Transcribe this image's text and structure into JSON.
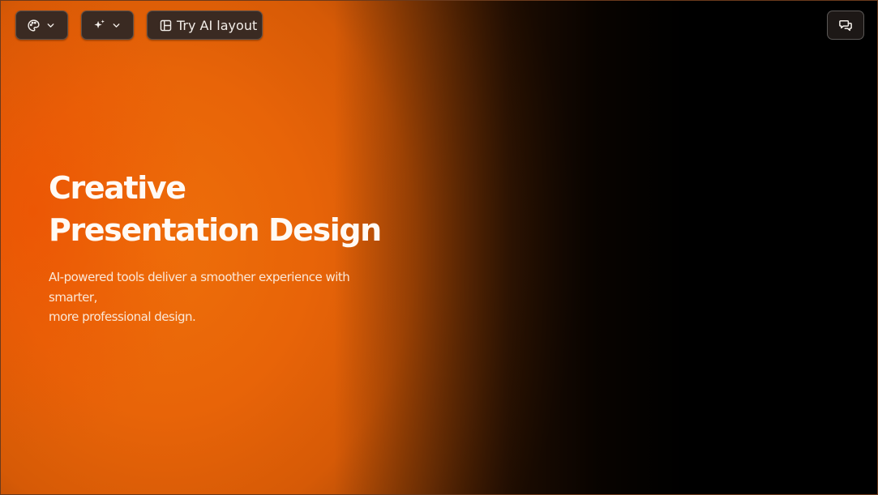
{
  "toolbar": {
    "theme_icon": "palette-icon",
    "ai_icon": "sparkles-icon",
    "layout_icon": "layout-icon",
    "layout_label": "Try AI layout",
    "chat_icon": "chat-bubbles-icon"
  },
  "slide": {
    "title": "Creative Presentation Design",
    "subtitle_lines": [
      "AI-powered tools deliver a smoother experience with",
      "smarter,",
      "more professional design."
    ]
  },
  "colors": {
    "accent_orange": "#ee6f0a",
    "background": "#000000",
    "button_bg": "#3a2a22",
    "title_text": "#fffaf5"
  }
}
